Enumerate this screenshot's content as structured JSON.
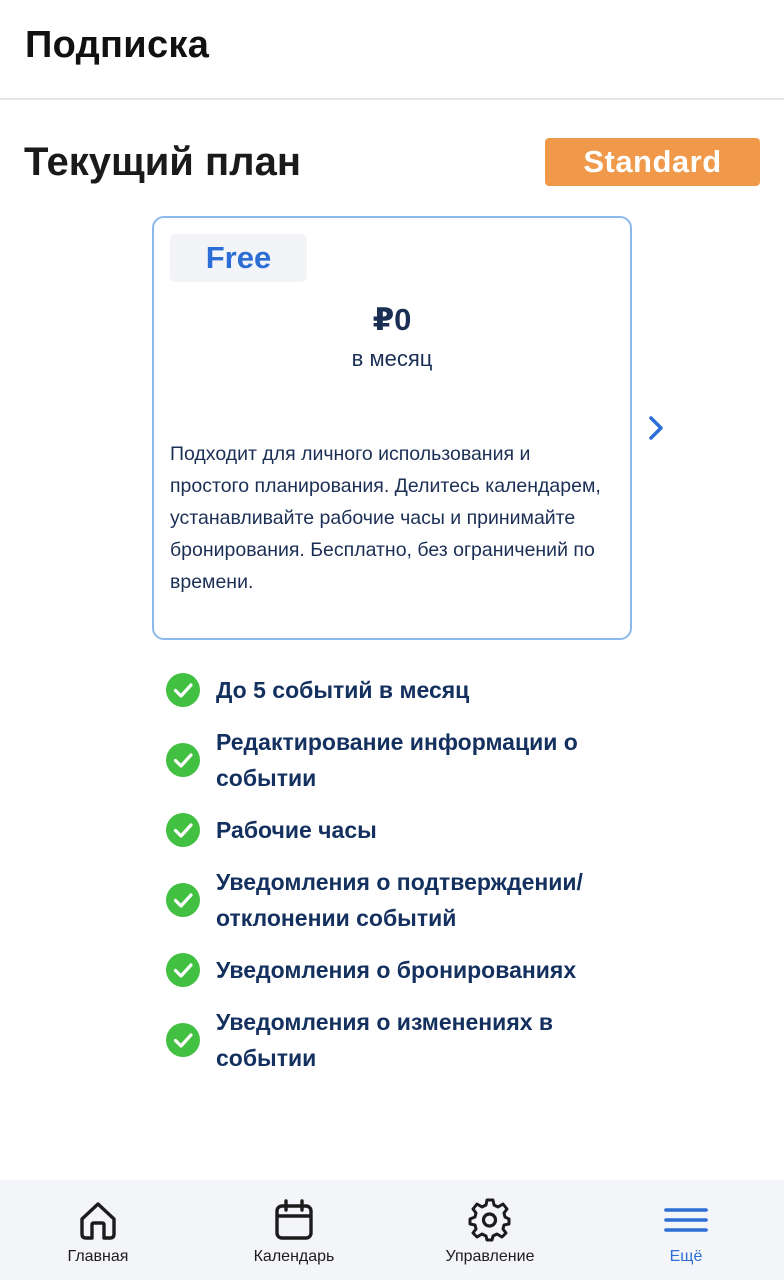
{
  "header": {
    "title": "Подписка"
  },
  "current_plan": {
    "heading": "Текущий план",
    "badge": "Standard"
  },
  "plan_card": {
    "name": "Free",
    "price": "₽0",
    "period": "в месяц",
    "description": "Подходит для личного использования и простого планирования. Делитесь календарем, устанавливайте рабочие часы и принимайте бронирования. Бесплатно, без ограничений по времени."
  },
  "features": [
    "До 5 событий в месяц",
    "Редактирование информации о событии",
    "Рабочие часы",
    "Уведомления о подтверждении/ отклонении событий",
    "Уведомления о бронированиях",
    "Уведомления о изменениях в событии"
  ],
  "bottom_nav": [
    {
      "label": "Главная",
      "icon": "home-icon"
    },
    {
      "label": "Календарь",
      "icon": "calendar-icon"
    },
    {
      "label": "Управление",
      "icon": "gear-icon"
    },
    {
      "label": "Ещё",
      "icon": "menu-icon"
    }
  ],
  "colors": {
    "badge_bg": "#f0994a",
    "accent": "#2c6ed5",
    "card_border": "#8db8ee",
    "check_green": "#41c041",
    "text_dark_blue": "#13305f"
  }
}
